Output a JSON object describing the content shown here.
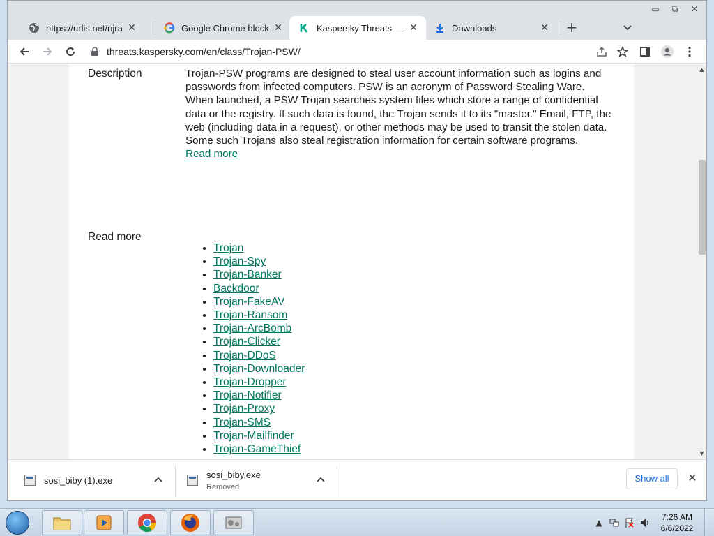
{
  "browser": {
    "tabs": [
      {
        "title": "https://urlis.net/njrat",
        "favicon": "globe-icon",
        "active": false
      },
      {
        "title": "Google Chrome blocks",
        "favicon": "google-icon",
        "active": false
      },
      {
        "title": "Kaspersky Threats — Tro",
        "favicon": "kaspersky-icon",
        "active": true
      },
      {
        "title": "Downloads",
        "favicon": "download-icon",
        "active": false
      }
    ],
    "address": "threats.kaspersky.com/en/class/Trojan-PSW/"
  },
  "page": {
    "description_label": "Description",
    "description_p1": "Trojan-PSW programs are designed to steal user account information such as logins and passwords from infected computers. PSW is an acronym of Password Stealing Ware.",
    "description_p2": "When launched, a PSW Trojan searches system files which store a range of confidential data or the registry. If such data is found, the Trojan sends it to its \"master.\" Email, FTP, the web (including data in a request), or other methods may be used to transit the stolen data.",
    "description_p3": "Some such Trojans also steal registration information for certain software programs.",
    "read_more_link": "Read more",
    "read_more_label": "Read more",
    "links": [
      "Trojan",
      "Trojan-Spy",
      "Trojan-Banker",
      "Backdoor",
      "Trojan-FakeAV",
      "Trojan-Ransom",
      "Trojan-ArcBomb",
      "Trojan-Clicker",
      "Trojan-DDoS",
      "Trojan-Downloader",
      "Trojan-Dropper",
      "Trojan-Notifier",
      "Trojan-Proxy",
      "Trojan-SMS",
      "Trojan-Mailfinder",
      "Trojan-GameThief"
    ]
  },
  "downloads": {
    "items": [
      {
        "name": "sosi_biby (1).exe",
        "status": ""
      },
      {
        "name": "sosi_biby.exe",
        "status": "Removed"
      }
    ],
    "show_all": "Show all"
  },
  "taskbar": {
    "time": "7:26 AM",
    "date": "6/6/2022"
  },
  "colors": {
    "link": "#00765f",
    "accent_blue": "#1a73e8"
  }
}
